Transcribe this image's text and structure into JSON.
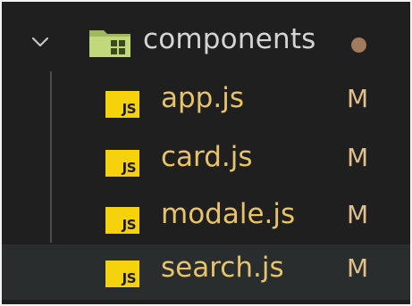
{
  "explorer": {
    "folder": {
      "label": "components",
      "expanded": true,
      "modified_dot_color": "#a07b5d",
      "icon": "folder-components-icon"
    },
    "files": [
      {
        "icon_text": "JS",
        "label": "app.js",
        "status": "M"
      },
      {
        "icon_text": "JS",
        "label": "card.js",
        "status": "M"
      },
      {
        "icon_text": "JS",
        "label": "modale.js",
        "status": "M"
      },
      {
        "icon_text": "JS",
        "label": "search.js",
        "status": "M",
        "hovered": true
      }
    ]
  },
  "colors": {
    "background": "#1f1f1f",
    "hover_background": "#2a2d2e",
    "js_icon": "#f5d20b",
    "file_label": "#e8c468",
    "status_modified": "#e2c08d"
  }
}
